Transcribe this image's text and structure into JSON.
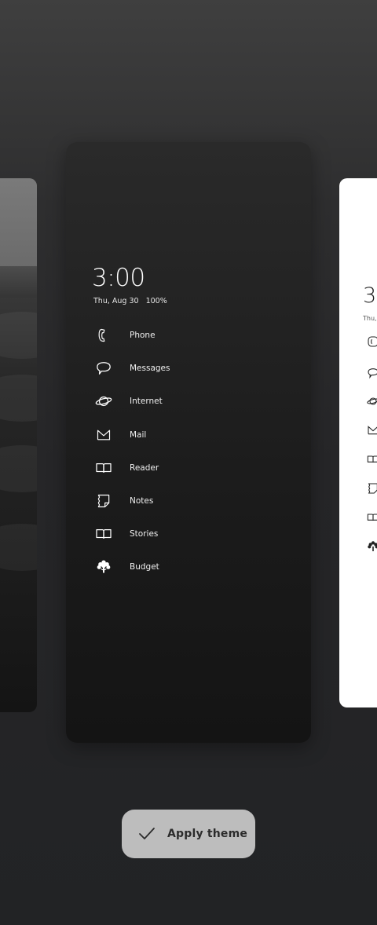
{
  "preview": {
    "clock": "3:00",
    "date": "Thu, Aug 30",
    "battery": "100%",
    "apps": [
      {
        "label": "Phone",
        "icon": "phone-icon"
      },
      {
        "label": "Messages",
        "icon": "message-bubble-icon"
      },
      {
        "label": "Internet",
        "icon": "planet-icon"
      },
      {
        "label": "Mail",
        "icon": "mail-icon"
      },
      {
        "label": "Reader",
        "icon": "open-book-icon"
      },
      {
        "label": "Notes",
        "icon": "note-icon"
      },
      {
        "label": "Stories",
        "icon": "open-book-icon"
      },
      {
        "label": "Budget",
        "icon": "tree-icon"
      }
    ]
  },
  "next_preview": {
    "clock_partial": "3",
    "date_partial": "Thu,"
  },
  "apply_button": {
    "label": "Apply theme",
    "icon": "checkmark-icon"
  },
  "colors": {
    "background_top": "#3f3f3f",
    "background_bottom": "#222325",
    "card_dark": "#1c1c1c",
    "card_light": "#ffffff",
    "button": "#bdbdbd"
  }
}
